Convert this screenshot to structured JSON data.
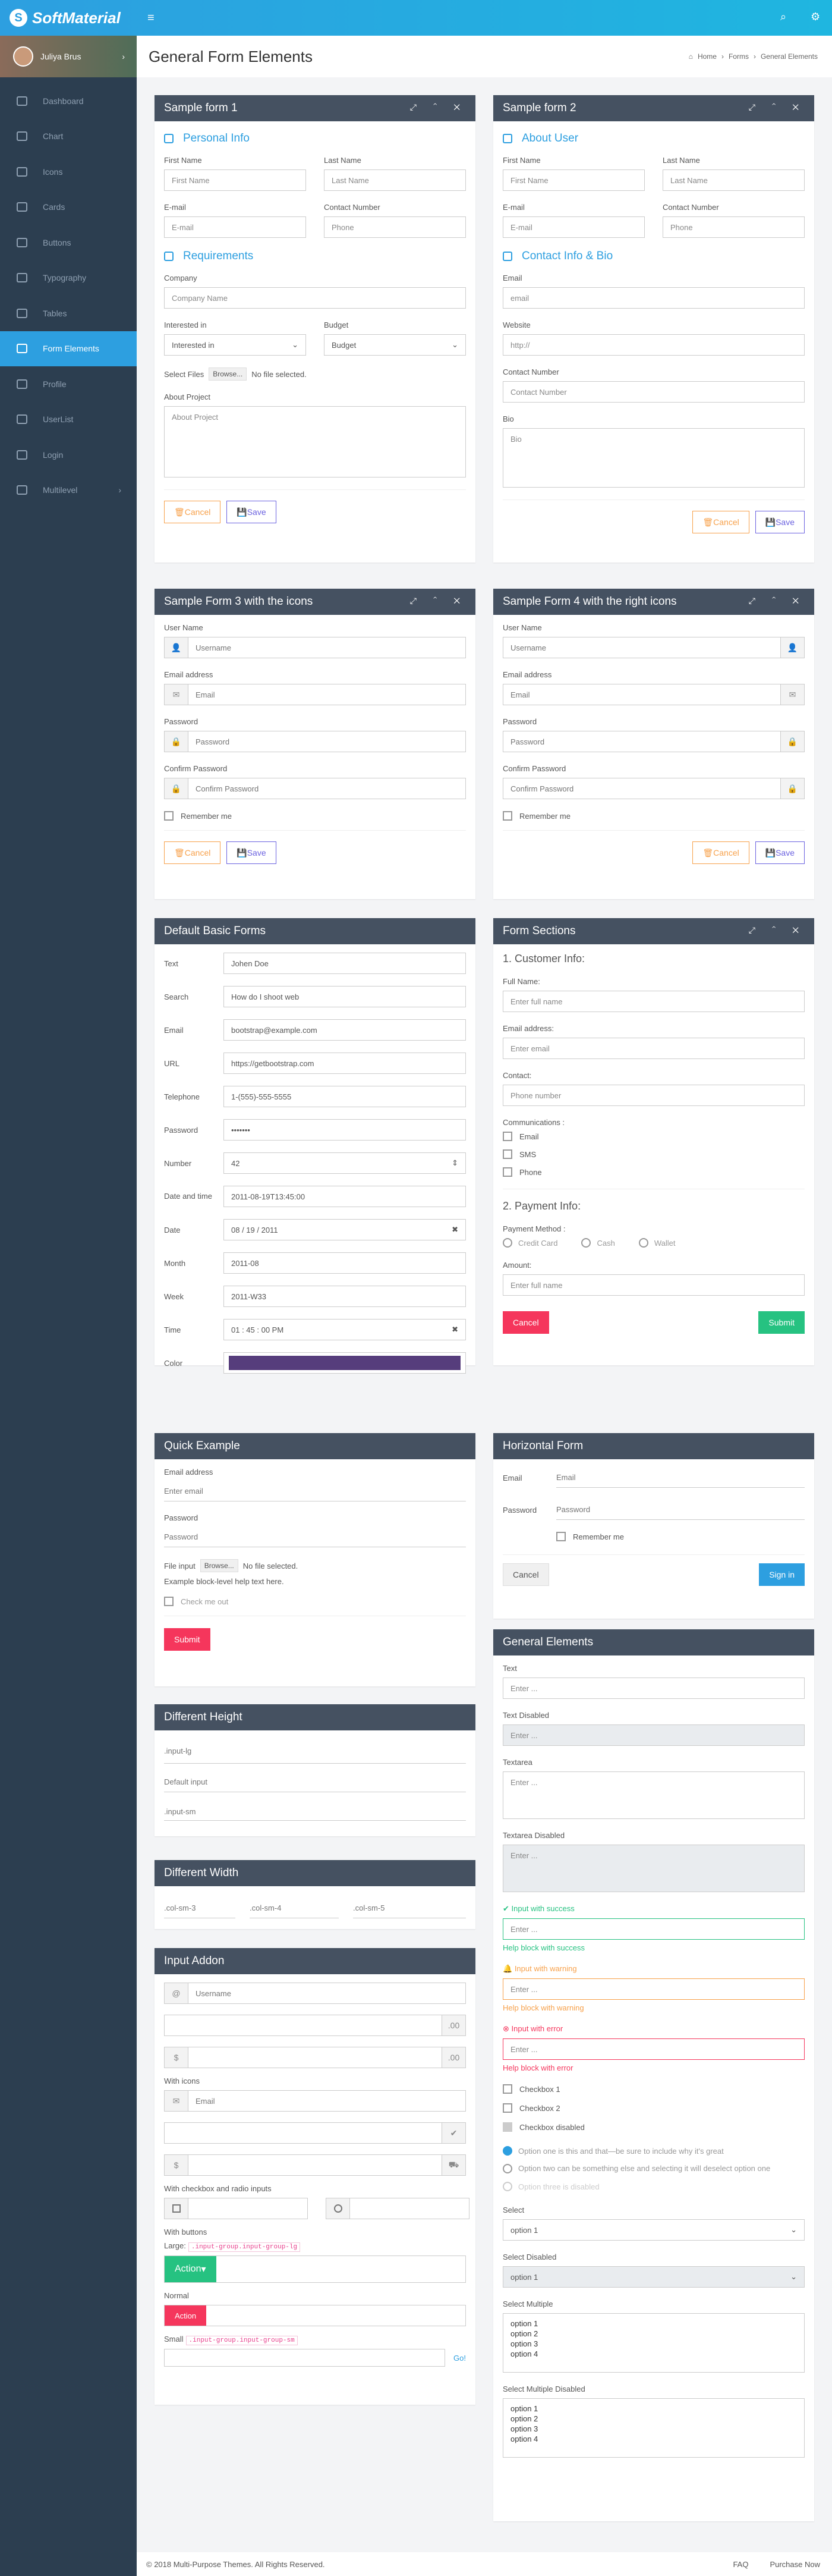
{
  "brand": {
    "name": "SoftMaterial"
  },
  "user": {
    "name": "Juliya Brus"
  },
  "sidebar": {
    "items": [
      {
        "label": "Dashboard"
      },
      {
        "label": "Chart"
      },
      {
        "label": "Icons"
      },
      {
        "label": "Cards"
      },
      {
        "label": "Buttons"
      },
      {
        "label": "Typography"
      },
      {
        "label": "Tables"
      },
      {
        "label": "Form Elements"
      },
      {
        "label": "Profile"
      },
      {
        "label": "UserList"
      },
      {
        "label": "Login"
      },
      {
        "label": "Multilevel"
      }
    ]
  },
  "page": {
    "title": "General Form Elements",
    "crumb_home": "Home",
    "crumb_forms": "Forms",
    "crumb_current": "General Elements"
  },
  "form1": {
    "title": "Sample form 1",
    "sec1": "Personal Info",
    "sec2": "Requirements",
    "first_name": "First Name",
    "last_name": "Last Name",
    "email": "E-mail",
    "contact": "Contact Number",
    "phone": "Phone",
    "company": "Company",
    "company_ph": "Company Name",
    "interested": "Interested in",
    "interested_val": "Interested in",
    "budget": "Budget",
    "budget_val": "Budget",
    "select_files": "Select Files",
    "browse": "Browse...",
    "no_file": "No file selected.",
    "about": "About Project",
    "about_ph": "About Project",
    "cancel": "Cancel",
    "save": "Save"
  },
  "form2": {
    "title": "Sample form 2",
    "sec1": "About User",
    "sec2": "Contact Info & Bio",
    "first_name": "First Name",
    "last_name": "Last Name",
    "email_lbl": "E-mail",
    "contact": "Contact Number",
    "phone": "Phone",
    "email2": "Email",
    "email2_ph": "email",
    "website": "Website",
    "website_ph": "http://",
    "contact2": "Contact Number",
    "contact2_ph": "Contact Number",
    "bio": "Bio",
    "bio_ph": "Bio",
    "cancel": "Cancel",
    "save": "Save"
  },
  "form3": {
    "title": "Sample Form 3 with the icons",
    "username": "User Name",
    "username_ph": "Username",
    "email": "Email address",
    "email_ph": "Email",
    "password": "Password",
    "password_ph": "Password",
    "confirm": "Confirm Password",
    "confirm_ph": "Confirm Password",
    "remember": "Remember me",
    "cancel": "Cancel",
    "save": "Save"
  },
  "form4": {
    "title": "Sample Form 4 with the right icons",
    "username": "User Name",
    "username_ph": "Username",
    "email": "Email address",
    "email_ph": "Email",
    "password": "Password",
    "password_ph": "Password",
    "confirm": "Confirm Password",
    "confirm_ph": "Confirm Password",
    "remember": "Remember me",
    "cancel": "Cancel",
    "save": "Save"
  },
  "basic": {
    "title": "Default Basic Forms",
    "rows": [
      {
        "label": "Text",
        "value": "Johen Doe"
      },
      {
        "label": "Search",
        "value": "How do I shoot web"
      },
      {
        "label": "Email",
        "value": "bootstrap@example.com"
      },
      {
        "label": "URL",
        "value": "https://getbootstrap.com"
      },
      {
        "label": "Telephone",
        "value": "1-(555)-555-5555"
      },
      {
        "label": "Password",
        "value": "•••••••"
      },
      {
        "label": "Number",
        "value": "42"
      },
      {
        "label": "Date and time",
        "value": "2011-08-19T13:45:00"
      },
      {
        "label": "Date",
        "value": "08 / 19 / 2011"
      },
      {
        "label": "Month",
        "value": "2011-08"
      },
      {
        "label": "Week",
        "value": "2011-W33"
      },
      {
        "label": "Time",
        "value": "01 : 45 : 00  PM"
      },
      {
        "label": "Color",
        "value": ""
      }
    ],
    "color": "#563d7c"
  },
  "sections": {
    "title": "Form Sections",
    "h1": "1. Customer Info:",
    "full_name": "Full Name:",
    "full_name_ph": "Enter full name",
    "email": "Email address:",
    "email_ph": "Enter email",
    "contact": "Contact:",
    "contact_ph": "Phone number",
    "comm": "Communications :",
    "c1": "Email",
    "c2": "SMS",
    "c3": "Phone",
    "h2": "2. Payment Info:",
    "pay": "Payment Method :",
    "p1": "Credit Card",
    "p2": "Cash",
    "p3": "Wallet",
    "amount": "Amount:",
    "amount_ph": "Enter full name",
    "cancel": "Cancel",
    "submit": "Submit"
  },
  "quick": {
    "title": "Quick Example",
    "email": "Email address",
    "email_ph": "Enter email",
    "password": "Password",
    "password_ph": "Password",
    "file": "File input",
    "browse": "Browse...",
    "no_file": "No file selected.",
    "help": "Example block-level help text here.",
    "check": "Check me out",
    "submit": "Submit"
  },
  "horizontal": {
    "title": "Horizontal Form",
    "email": "Email",
    "email_ph": "Email",
    "password": "Password",
    "password_ph": "Password",
    "remember": "Remember me",
    "cancel": "Cancel",
    "signin": "Sign in"
  },
  "height": {
    "title": "Different Height",
    "lg": ".input-lg",
    "def": "Default input",
    "sm": ".input-sm"
  },
  "width": {
    "title": "Different Width",
    "c3": ".col-sm-3",
    "c4": ".col-sm-4",
    "c5": ".col-sm-5"
  },
  "addon": {
    "title": "Input Addon",
    "at": "@",
    "user_ph": "Username",
    "dec": ".00",
    "dollar": "$",
    "with_icons": "With icons",
    "email_ph": "Email",
    "with_cb": "With checkbox and radio inputs",
    "with_btn": "With buttons",
    "large": "Large:",
    "large_code": ".input-group.input-group-lg",
    "action": "Action",
    "normal": "Normal",
    "action2": "Action",
    "small": "Small",
    "small_code": ".input-group.input-group-sm",
    "go": "Go!"
  },
  "general": {
    "title": "General Elements",
    "text": "Text",
    "enter": "Enter ...",
    "text_dis": "Text Disabled",
    "textarea": "Textarea",
    "textarea_dis": "Textarea Disabled",
    "success": "Input with success",
    "success_help": "Help block with success",
    "warning": "Input with warning",
    "warning_help": "Help block with warning",
    "error": "Input with error",
    "error_help": "Help block with error",
    "cb1": "Checkbox 1",
    "cb2": "Checkbox 2",
    "cb3": "Checkbox disabled",
    "r1": "Option one is this and that—be sure to include why it's great",
    "r2": "Option two can be something else and selecting it will deselect option one",
    "r3": "Option three is disabled",
    "select": "Select",
    "opt1": "option 1",
    "select_dis": "Select Disabled",
    "select_multi": "Select Multiple",
    "select_multi_dis": "Select Multiple Disabled",
    "options": [
      "option 1",
      "option 2",
      "option 3",
      "option 4"
    ]
  },
  "footer": {
    "copy": "© 2018 Multi-Purpose Themes. All Rights Reserved.",
    "faq": "FAQ",
    "purchase": "Purchase Now"
  }
}
